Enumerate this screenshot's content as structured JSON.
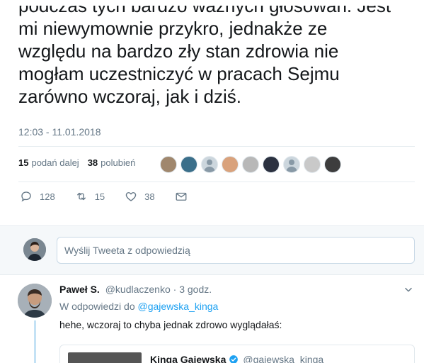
{
  "tweet": {
    "lines": [
      "podczas tych bardzo ważnych głosowań. Jest",
      "mi niewymownie przykro, jednakże ze",
      "względu na bardzo zły stan zdrowia nie",
      "mogłam uczestniczyć w pracach Sejmu",
      "zarówno wczoraj, jak i dziś."
    ],
    "timestamp": "12:03 - 11.01.2018"
  },
  "stats": {
    "retweets_count": "15",
    "retweets_label": "podań dalej",
    "likes_count": "38",
    "likes_label": "polubień",
    "avatar_colors": [
      "#a0876d",
      "#3b6f8a",
      "#ccd6dd",
      "#d9a27c",
      "#b8b8b8",
      "#2b3140",
      "#ccd6dd",
      "#c9c9c9",
      "#3d3d3d"
    ]
  },
  "actions": {
    "reply_icon": "reply-icon",
    "reply_count": "128",
    "retweet_icon": "retweet-icon",
    "retweet_count": "15",
    "like_icon": "heart-icon",
    "like_count": "38",
    "dm_icon": "envelope-icon"
  },
  "reply_box": {
    "placeholder": "Wyślij Tweeta z odpowiedzią"
  },
  "reply": {
    "name": "Paweł S.",
    "handle": "@kudlaczenko",
    "time": "· 3 godz.",
    "in_reply_prefix": "W odpowiedzi do",
    "in_reply_handle": "@gajewska_kinga",
    "text": "hehe, wczoraj to chyba jednak zdrowo wyglądałaś:"
  },
  "quote": {
    "name": "Kinga Gajewska",
    "handle": "@gajewska_kinga"
  },
  "colors": {
    "accent": "#1da1f2",
    "muted": "#657786",
    "band": "#f5f8fa"
  }
}
